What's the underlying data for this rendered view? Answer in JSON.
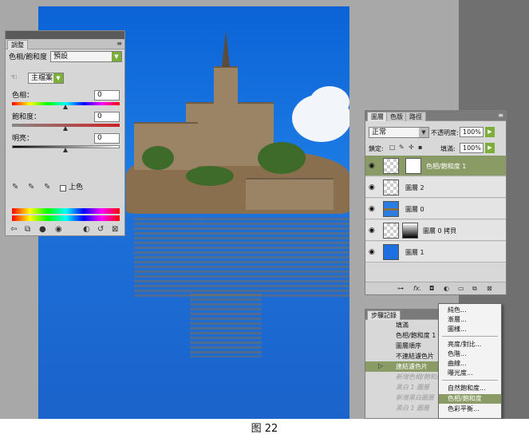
{
  "adjustments": {
    "tab_label": "調整",
    "adjustment_name": "色相/飽和度",
    "preset_value": "預設",
    "channel_value": "主檔案",
    "hue_label": "色相：",
    "hue_value": "0",
    "saturation_label": "飽和度：",
    "saturation_value": "0",
    "lightness_label": "明亮：",
    "lightness_value": "0",
    "colorize_label": "上色"
  },
  "layers": {
    "tabs": [
      "圖層",
      "色版",
      "路徑"
    ],
    "blend_mode": "正常",
    "opacity_label": "不透明度:",
    "opacity_value": "100%",
    "lock_label": "鎖定:",
    "fill_label": "填滿:",
    "fill_value": "100%",
    "items": [
      {
        "name": "色相/飽和度 1",
        "selected": true,
        "thumb": "adjustment"
      },
      {
        "name": "圖層 2",
        "selected": false,
        "thumb": "checker"
      },
      {
        "name": "圖層 0",
        "selected": false,
        "thumb": "photo"
      },
      {
        "name": "圖層 0 拷貝",
        "selected": false,
        "thumb": "mask"
      },
      {
        "name": "圖層 1",
        "selected": false,
        "thumb": "blue"
      }
    ]
  },
  "history": {
    "tab_label": "步驟記錄",
    "items": [
      {
        "text": "填滿",
        "state": "normal"
      },
      {
        "text": "色相/飽和度 1",
        "state": "normal"
      },
      {
        "text": "圖層順序",
        "state": "normal"
      },
      {
        "text": "不連結濾色片",
        "state": "normal"
      },
      {
        "text": "連結濾色片",
        "state": "active"
      },
      {
        "text": "新增色相/飽和度",
        "state": "ghost"
      },
      {
        "text": "黑白 1 圖層",
        "state": "ghost"
      },
      {
        "text": "新增黑白圖層",
        "state": "ghost"
      },
      {
        "text": "黑白 1 圖層",
        "state": "ghost"
      }
    ]
  },
  "context_menu": {
    "items": [
      {
        "label": "純色...",
        "highlight": false
      },
      {
        "label": "漸層...",
        "highlight": false
      },
      {
        "label": "圖樣...",
        "highlight": false
      },
      {
        "label": "亮度/對比...",
        "highlight": false
      },
      {
        "label": "色階...",
        "highlight": false
      },
      {
        "label": "曲線...",
        "highlight": false
      },
      {
        "label": "曝光度...",
        "highlight": false
      },
      {
        "label": "自然飽和度...",
        "highlight": false
      },
      {
        "label": "色相/飽和度",
        "highlight": true
      },
      {
        "label": "色彩平衡...",
        "highlight": false
      }
    ]
  },
  "caption": "图 22",
  "colors": {
    "workspace": "#a8a8a8",
    "selection": "#8a9b66",
    "dropdown_accent": "#7cae3a"
  }
}
